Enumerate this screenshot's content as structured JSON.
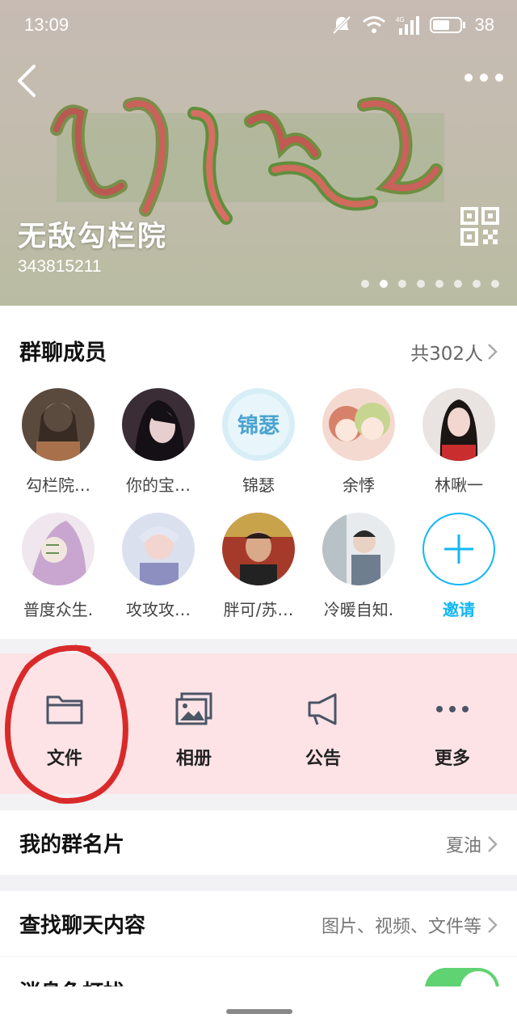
{
  "status_bar": {
    "time": "13:09",
    "network": "4G",
    "battery": "38"
  },
  "header": {
    "group_name": "无敌勾栏院",
    "group_id": "343815211",
    "page_count": 8,
    "active_page": 1
  },
  "members_section": {
    "title": "群聊成员",
    "count": "共302人",
    "row1": [
      {
        "label": "勾栏院…"
      },
      {
        "label": "你的宝…"
      },
      {
        "label": "锦瑟"
      },
      {
        "label": "余悸"
      },
      {
        "label": "林啾一"
      }
    ],
    "row2": [
      {
        "label": "普度众生."
      },
      {
        "label": "攻攻攻…"
      },
      {
        "label": "胖可/苏…"
      },
      {
        "label": "冷暖自知."
      }
    ],
    "invite_label": "邀请"
  },
  "actions": [
    {
      "label": "文件",
      "icon": "folder-icon"
    },
    {
      "label": "相册",
      "icon": "album-icon"
    },
    {
      "label": "公告",
      "icon": "megaphone-icon"
    },
    {
      "label": "更多",
      "icon": "more-icon"
    }
  ],
  "rows": {
    "card": {
      "title": "我的群名片",
      "value": "夏油"
    },
    "search": {
      "title": "查找聊天内容",
      "value": "图片、视频、文件等"
    },
    "mute": {
      "title": "消息免打扰"
    }
  },
  "colors": {
    "accent": "#12b7f5",
    "action_bg": "#fde3e6",
    "toggle_on": "#5fd372",
    "annotation": "#d92a2a"
  }
}
